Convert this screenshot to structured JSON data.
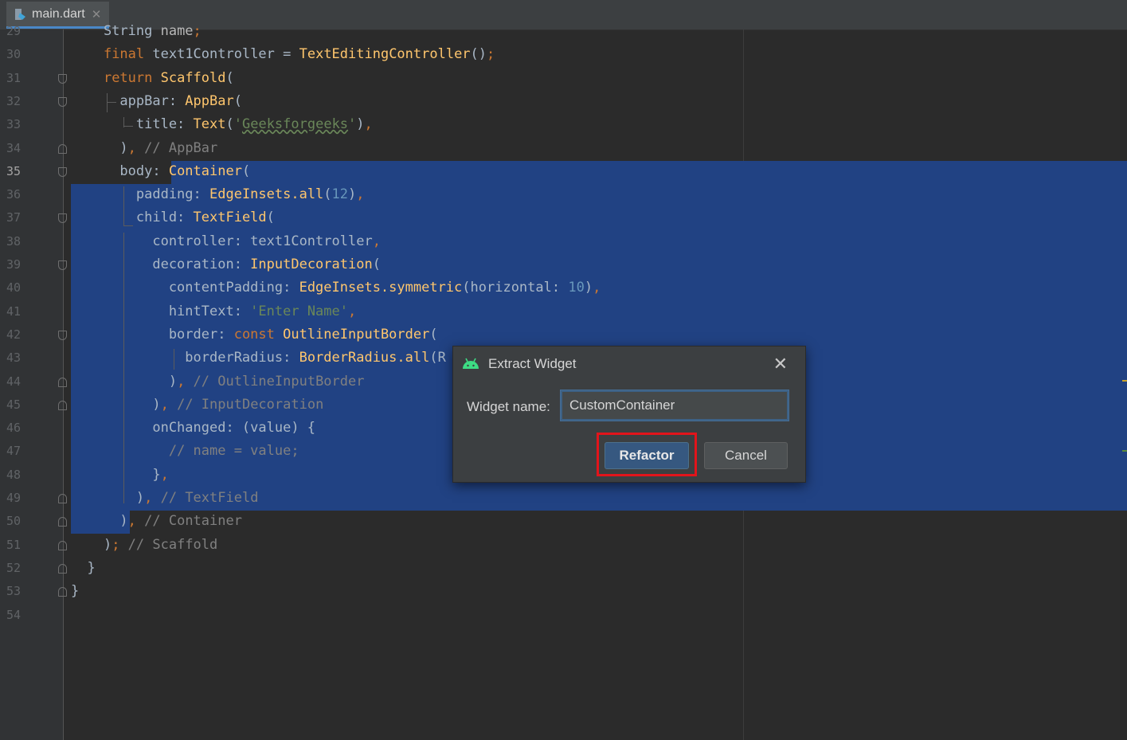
{
  "tab": {
    "filename": "main.dart",
    "close_glyph": "✕"
  },
  "code_lines": [
    {
      "num": "29",
      "segs": [
        {
          "t": "    String ",
          "c": ""
        },
        {
          "t": "name",
          "c": "prm"
        },
        {
          "t": ";",
          "c": "kw"
        }
      ]
    },
    {
      "num": "30",
      "segs": [
        {
          "t": "    ",
          "c": ""
        },
        {
          "t": "final ",
          "c": "kw"
        },
        {
          "t": "text1Controller = ",
          "c": ""
        },
        {
          "t": "TextEditingController",
          "c": "fn"
        },
        {
          "t": "()",
          "c": ""
        },
        {
          "t": ";",
          "c": "kw"
        }
      ]
    },
    {
      "num": "31",
      "segs": [
        {
          "t": "    ",
          "c": ""
        },
        {
          "t": "return ",
          "c": "kw"
        },
        {
          "t": "Scaffold",
          "c": "fn"
        },
        {
          "t": "(",
          "c": ""
        }
      ]
    },
    {
      "num": "32",
      "segs": [
        {
          "t": "      appBar: ",
          "c": ""
        },
        {
          "t": "AppBar",
          "c": "fn"
        },
        {
          "t": "(",
          "c": ""
        }
      ]
    },
    {
      "num": "33",
      "segs": [
        {
          "t": "        title: ",
          "c": ""
        },
        {
          "t": "Text",
          "c": "fn"
        },
        {
          "t": "(",
          "c": ""
        },
        {
          "t": "'",
          "c": "str"
        },
        {
          "t": "Geeksforgeeks",
          "c": "str ul"
        },
        {
          "t": "'",
          "c": "str"
        },
        {
          "t": ")",
          "c": ""
        },
        {
          "t": ",",
          "c": "kw"
        }
      ]
    },
    {
      "num": "34",
      "segs": [
        {
          "t": "      )",
          "c": ""
        },
        {
          "t": ", ",
          "c": "kw"
        },
        {
          "t": "// AppBar",
          "c": "cm"
        }
      ]
    },
    {
      "num": "35",
      "segs": [
        {
          "t": "      body: ",
          "c": ""
        },
        {
          "t": "Container",
          "c": "fn"
        },
        {
          "t": "(",
          "c": ""
        }
      ]
    },
    {
      "num": "36",
      "segs": [
        {
          "t": "        padding: ",
          "c": ""
        },
        {
          "t": "EdgeInsets.all",
          "c": "fn"
        },
        {
          "t": "(",
          "c": ""
        },
        {
          "t": "12",
          "c": "num"
        },
        {
          "t": ")",
          "c": ""
        },
        {
          "t": ",",
          "c": "kw"
        }
      ]
    },
    {
      "num": "37",
      "segs": [
        {
          "t": "        child: ",
          "c": ""
        },
        {
          "t": "TextField",
          "c": "fn"
        },
        {
          "t": "(",
          "c": ""
        }
      ]
    },
    {
      "num": "38",
      "segs": [
        {
          "t": "          controller: text1Controller",
          "c": ""
        },
        {
          "t": ",",
          "c": "kw"
        }
      ]
    },
    {
      "num": "39",
      "segs": [
        {
          "t": "          decoration: ",
          "c": ""
        },
        {
          "t": "InputDecoration",
          "c": "fn"
        },
        {
          "t": "(",
          "c": ""
        }
      ]
    },
    {
      "num": "40",
      "segs": [
        {
          "t": "            contentPadding: ",
          "c": ""
        },
        {
          "t": "EdgeInsets.symmetric",
          "c": "fn"
        },
        {
          "t": "(horizontal: ",
          "c": ""
        },
        {
          "t": "10",
          "c": "num"
        },
        {
          "t": ")",
          "c": ""
        },
        {
          "t": ",",
          "c": "kw"
        }
      ]
    },
    {
      "num": "41",
      "segs": [
        {
          "t": "            hintText: ",
          "c": ""
        },
        {
          "t": "'Enter Name'",
          "c": "str"
        },
        {
          "t": ",",
          "c": "kw"
        }
      ]
    },
    {
      "num": "42",
      "segs": [
        {
          "t": "            border: ",
          "c": ""
        },
        {
          "t": "const ",
          "c": "kw"
        },
        {
          "t": "OutlineInputBorder",
          "c": "fn"
        },
        {
          "t": "(",
          "c": ""
        }
      ]
    },
    {
      "num": "43",
      "segs": [
        {
          "t": "              borderRadius: ",
          "c": ""
        },
        {
          "t": "BorderRadius.all",
          "c": "fn"
        },
        {
          "t": "(R",
          "c": ""
        }
      ]
    },
    {
      "num": "44",
      "segs": [
        {
          "t": "            )",
          "c": ""
        },
        {
          "t": ", ",
          "c": "kw"
        },
        {
          "t": "// OutlineInputBorder",
          "c": "cm"
        }
      ]
    },
    {
      "num": "45",
      "segs": [
        {
          "t": "          )",
          "c": ""
        },
        {
          "t": ", ",
          "c": "kw"
        },
        {
          "t": "// InputDecoration",
          "c": "cm"
        }
      ]
    },
    {
      "num": "46",
      "segs": [
        {
          "t": "          onChanged: (value) {",
          "c": ""
        }
      ]
    },
    {
      "num": "47",
      "segs": [
        {
          "t": "            ",
          "c": ""
        },
        {
          "t": "// name = value;",
          "c": "cm"
        }
      ]
    },
    {
      "num": "48",
      "segs": [
        {
          "t": "          }",
          "c": ""
        },
        {
          "t": ",",
          "c": "kw"
        }
      ]
    },
    {
      "num": "49",
      "segs": [
        {
          "t": "        )",
          "c": ""
        },
        {
          "t": ", ",
          "c": "kw"
        },
        {
          "t": "// TextField",
          "c": "cm"
        }
      ]
    },
    {
      "num": "50",
      "segs": [
        {
          "t": "      )",
          "c": ""
        },
        {
          "t": ", ",
          "c": "kw"
        },
        {
          "t": "// Container",
          "c": "cm"
        }
      ]
    },
    {
      "num": "51",
      "segs": [
        {
          "t": "    )",
          "c": ""
        },
        {
          "t": "; ",
          "c": "kw"
        },
        {
          "t": "// Scaffold",
          "c": "cm"
        }
      ]
    },
    {
      "num": "52",
      "segs": [
        {
          "t": "  }",
          "c": ""
        }
      ]
    },
    {
      "num": "53",
      "segs": [
        {
          "t": "}",
          "c": ""
        }
      ]
    },
    {
      "num": "54",
      "segs": []
    }
  ],
  "current_line": "35",
  "dialog": {
    "title": "Extract Widget",
    "close_glyph": "✕",
    "label": "Widget name:",
    "input_value": "CustomContainer",
    "refactor_label": "Refactor",
    "cancel_label": "Cancel"
  },
  "colors": {
    "editor_bg": "#2b2b2b",
    "selection": "#214283",
    "keyword": "#cc7832",
    "function": "#ffc66d",
    "string": "#6a8759",
    "number": "#6897bb",
    "comment": "#808080",
    "highlight_box": "#e2141b",
    "android_green": "#3ddc84"
  }
}
